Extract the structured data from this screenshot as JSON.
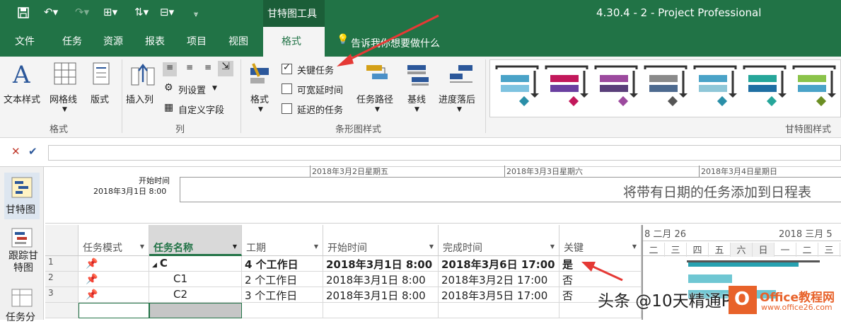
{
  "window": {
    "context_tab_group": "甘特图工具",
    "title": "4.30.4 - 2  -  Project Professional"
  },
  "tabs": [
    "文件",
    "任务",
    "资源",
    "报表",
    "项目",
    "视图",
    "格式"
  ],
  "tellme": "告诉我你想要做什么",
  "ribbon": {
    "format_group": {
      "label": "格式",
      "text_style": "文本样式",
      "gridlines": "网格线",
      "layout": "版式"
    },
    "columns_group": {
      "label": "列",
      "insert_column": "插入列",
      "column_settings": "列设置",
      "custom_fields": "自定义字段"
    },
    "bar_styles_group": {
      "label": "条形图样式",
      "format": "格式",
      "critical_tasks": "关键任务",
      "slack": "可宽延时间",
      "late_tasks": "延迟的任务",
      "task_path": "任务路径",
      "baseline": "基线",
      "slippage": "进度落后"
    },
    "gantt_style_group": {
      "label": "甘特图样式"
    }
  },
  "gantt_styles": [
    {
      "top": "#4aa3c8",
      "bottom": "#7ec3e0",
      "diamond": "#2a8fa8"
    },
    {
      "top": "#c2185b",
      "bottom": "#6a3fa0",
      "diamond": "#c2185b"
    },
    {
      "top": "#9c4a9e",
      "bottom": "#5a3f7a",
      "diamond": "#9c4a9e"
    },
    {
      "top": "#8a8a8a",
      "bottom": "#4d6a8f",
      "diamond": "#555555"
    },
    {
      "top": "#4aa3c8",
      "bottom": "#8fc7d8",
      "diamond": "#2a8fa8"
    },
    {
      "top": "#26a69a",
      "bottom": "#1f6fa3",
      "diamond": "#26a69a"
    },
    {
      "top": "#8bc34a",
      "bottom": "#4aa3c8",
      "diamond": "#6b8e23"
    }
  ],
  "formula": {
    "cancel": "✕",
    "enter": "✔",
    "value": ""
  },
  "leftnav": {
    "gantt": "甘特图",
    "tracking": "跟踪甘特图",
    "usage": "任务分"
  },
  "timeline": {
    "start_label": "开始时间",
    "start_value": "2018年3月1日  8:00",
    "dates": [
      "2018年3月2日星期五",
      "2018年3月3日星期六",
      "2018年3月4日星期日"
    ],
    "placeholder": "将带有日期的任务添加到日程表"
  },
  "table": {
    "headers": [
      "任务模式",
      "任务名称",
      "工期",
      "开始时间",
      "完成时间",
      "关键"
    ],
    "rows": [
      {
        "id": "1",
        "name": "C",
        "duration": "4 个工作日",
        "start": "2018年3月1日 8:00",
        "finish": "2018年3月6日 17:00",
        "critical": "是",
        "summary": true
      },
      {
        "id": "2",
        "name": "C1",
        "duration": "2 个工作日",
        "start": "2018年3月1日 8:00",
        "finish": "2018年3月2日 17:00",
        "critical": "否",
        "summary": false
      },
      {
        "id": "3",
        "name": "C2",
        "duration": "3 个工作日",
        "start": "2018年3月1日 8:00",
        "finish": "2018年3月5日 17:00",
        "critical": "否",
        "summary": false
      }
    ]
  },
  "gantt_chart": {
    "week1": "8 二月 26",
    "week2": "2018 三月 5",
    "days": [
      "二",
      "三",
      "四",
      "五",
      "六",
      "日",
      "一",
      "二",
      "三"
    ]
  },
  "watermark": {
    "text": "头条 @10天精通PPT",
    "brand": "Office教程网",
    "url": "www.office26.com"
  }
}
